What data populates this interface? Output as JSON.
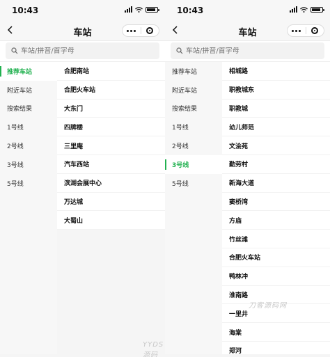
{
  "screens": [
    {
      "status": {
        "time": "10:43"
      },
      "nav": {
        "title": "车站"
      },
      "search": {
        "placeholder": "车站/拼音/首字母"
      },
      "sidebar": [
        {
          "label": "推荐车站",
          "active": true
        },
        {
          "label": "附近车站"
        },
        {
          "label": "搜索结果"
        },
        {
          "label": "1号线"
        },
        {
          "label": "2号线"
        },
        {
          "label": "3号线"
        },
        {
          "label": "5号线"
        }
      ],
      "stations": [
        "合肥南站",
        "合肥火车站",
        "大东门",
        "四牌楼",
        "三里庵",
        "汽车西站",
        "滨湖会展中心",
        "万达城",
        "大蜀山"
      ]
    },
    {
      "status": {
        "time": "10:43"
      },
      "nav": {
        "title": "车站"
      },
      "search": {
        "placeholder": "车站/拼音/首字母"
      },
      "sidebar": [
        {
          "label": "推荐车站"
        },
        {
          "label": "附近车站"
        },
        {
          "label": "搜索结果"
        },
        {
          "label": "1号线"
        },
        {
          "label": "2号线"
        },
        {
          "label": "3号线",
          "active": true
        },
        {
          "label": "5号线"
        }
      ],
      "stations": [
        "相城路",
        "职教城东",
        "职教城",
        "幼儿师范",
        "文浍苑",
        "勤劳村",
        "新海大道",
        "窦桥湾",
        "方庙",
        "竹丝滩",
        "合肥火车站",
        "鸭林冲",
        "淮南路",
        "一里井",
        "海棠",
        "郑河"
      ]
    }
  ],
  "watermarks": [
    "YYDS源码网",
    "刀客源码网"
  ],
  "colors": {
    "accent": "#22b150"
  }
}
